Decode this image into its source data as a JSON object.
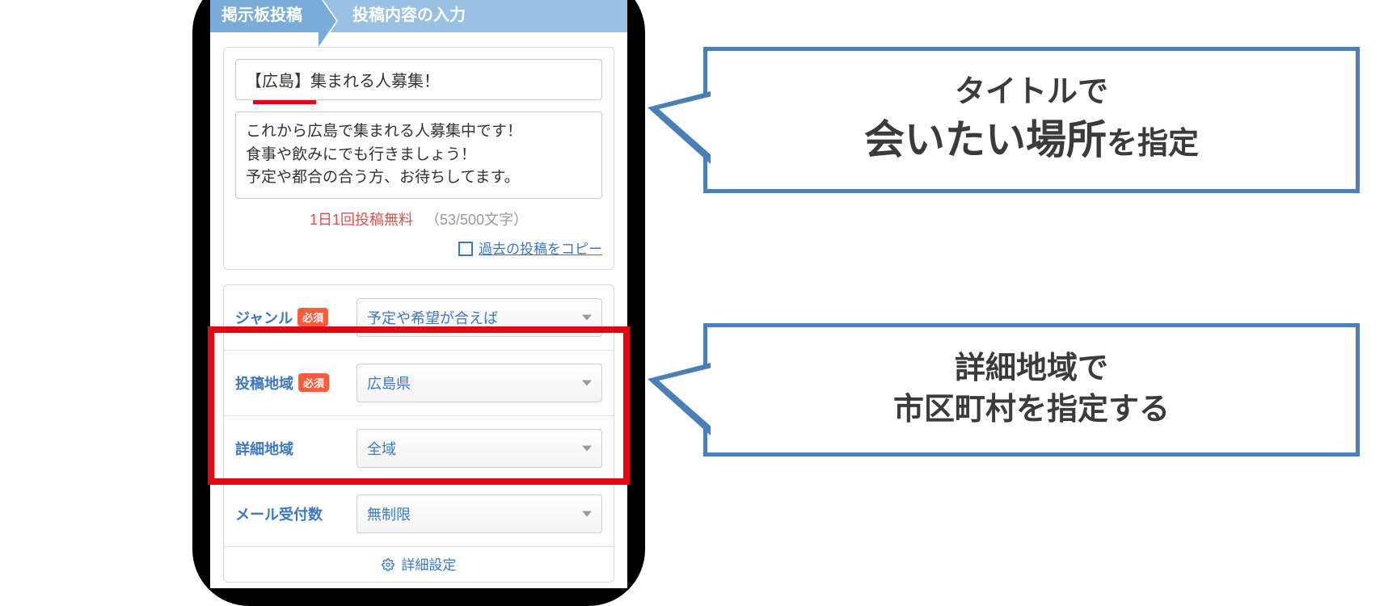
{
  "breadcrumb": {
    "step1": "掲示板投稿",
    "step2": "投稿内容の入力"
  },
  "form": {
    "title_value": "【広島】集まれる人募集！",
    "body_value": "これから広島で集まれる人募集中です！\n食事や飲みにでも行きましょう！\n予定や都合の合う方、お待ちしてます。",
    "free_once_label": "1日1回投稿無料",
    "char_count": "（53/500文字）",
    "copy_past_label": "過去の投稿をコピー"
  },
  "rows": {
    "required_badge": "必須",
    "genre": {
      "label": "ジャンル",
      "value": "予定や希望が合えば"
    },
    "region": {
      "label": "投稿地域",
      "value": "広島県"
    },
    "subregion": {
      "label": "詳細地域",
      "value": "全域"
    },
    "mailcap": {
      "label": "メール受付数",
      "value": "無制限"
    },
    "detail_settings": "詳細設定"
  },
  "callouts": {
    "c1_line1": "タイトルで",
    "c1_big": "会いたい場所",
    "c1_tail": "を指定",
    "c2_line1": "詳細地域で",
    "c2_line2": "市区町村を指定する"
  }
}
